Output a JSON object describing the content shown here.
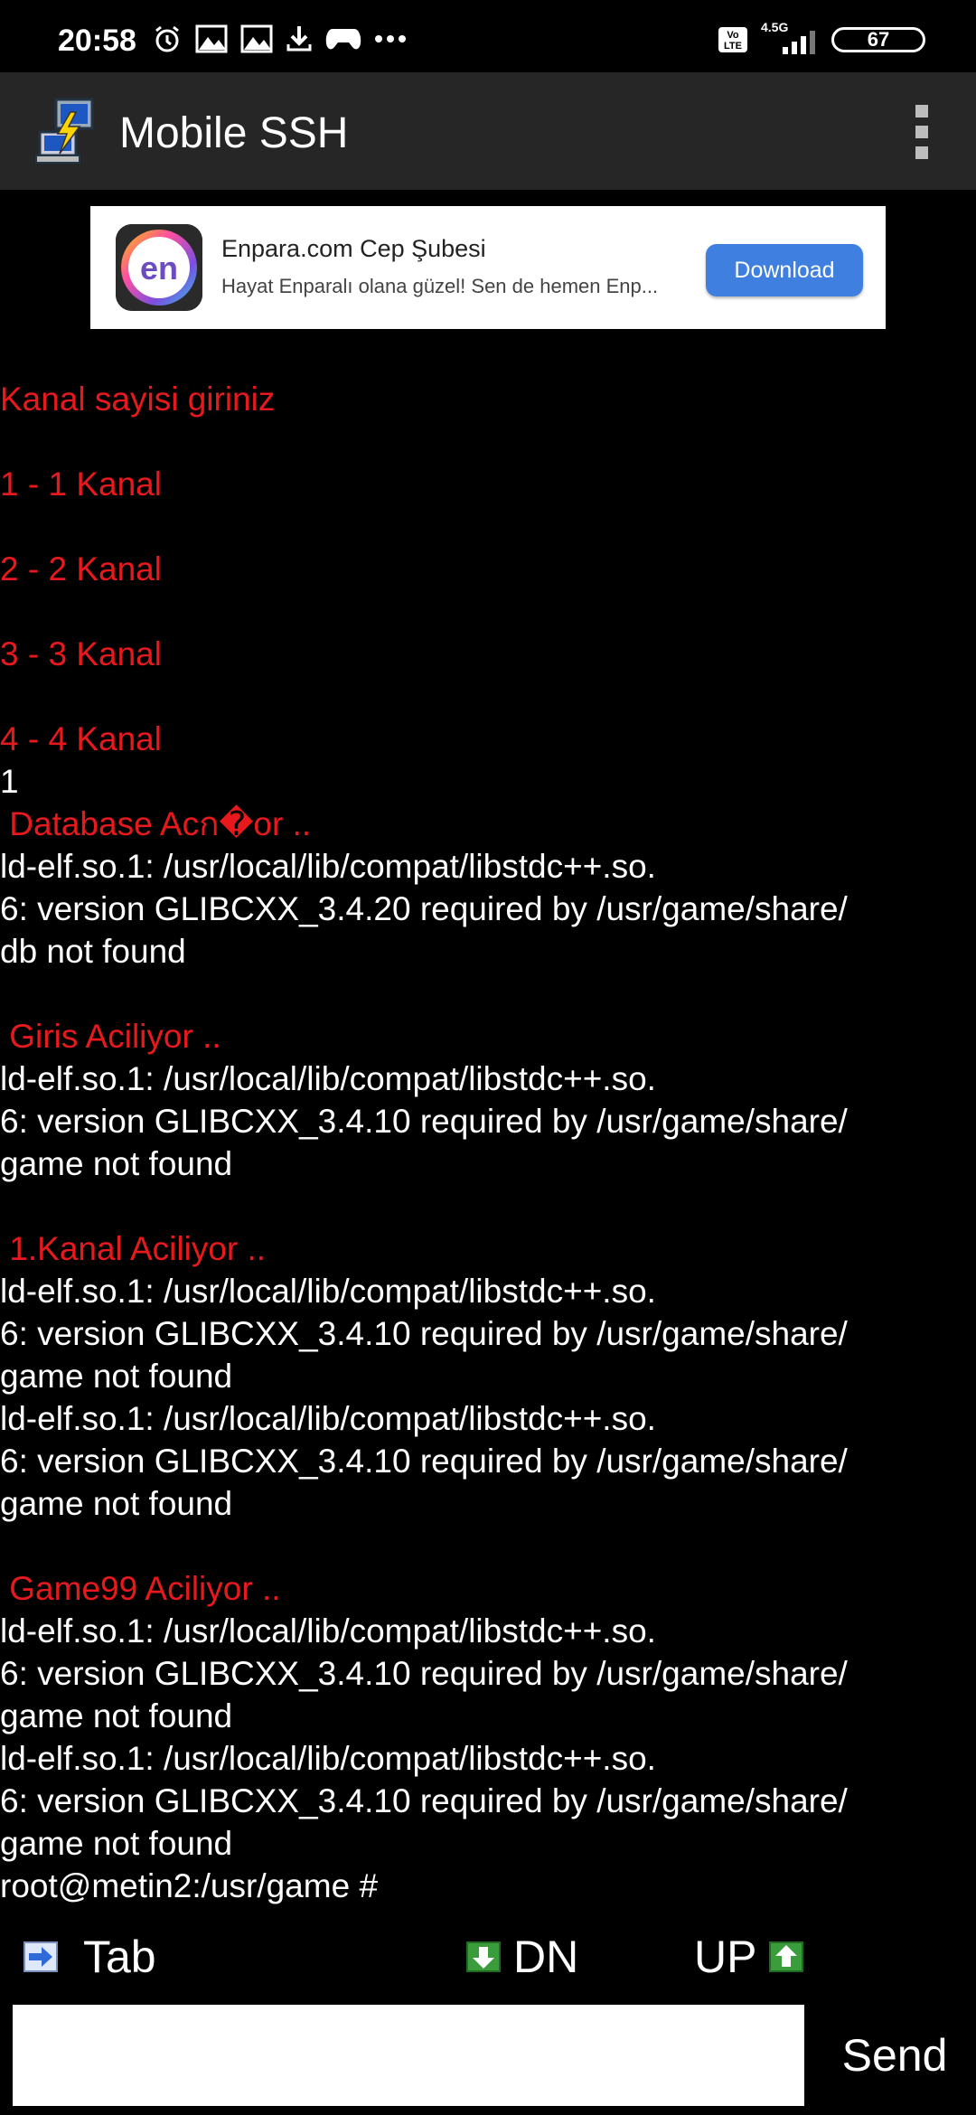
{
  "status_bar": {
    "time": "20:58",
    "network": "4.5G",
    "volte": "Vo LTE",
    "battery": "67",
    "icons": [
      "alarm-icon",
      "gallery-icon",
      "gallery-icon",
      "download-icon",
      "game-controller-icon",
      "more-dots-icon"
    ]
  },
  "app_bar": {
    "title": "Mobile SSH",
    "menu_icon": "overflow-menu-icon"
  },
  "ad": {
    "logo_text": "en",
    "title": "Enpara.com Cep Şubesi",
    "subtitle": "Hayat Enparalı olana güzel! Sen de hemen Enp...",
    "button": "Download"
  },
  "terminal": {
    "lines": [
      {
        "text": "Kanal sayisi giriniz",
        "color": "red"
      },
      {
        "text": "",
        "color": "white"
      },
      {
        "text": "1 - 1 Kanal",
        "color": "red"
      },
      {
        "text": "",
        "color": "white"
      },
      {
        "text": "2 - 2 Kanal",
        "color": "red"
      },
      {
        "text": "",
        "color": "white"
      },
      {
        "text": "3 - 3 Kanal",
        "color": "red"
      },
      {
        "text": "",
        "color": "white"
      },
      {
        "text": "4 - 4 Kanal",
        "color": "red"
      },
      {
        "text": "1",
        "color": "white"
      },
      {
        "text": " Database Acก�or ..",
        "color": "red"
      },
      {
        "text": "ld-elf.so.1: /usr/local/lib/compat/libstdc++.so.",
        "color": "white"
      },
      {
        "text": "6: version GLIBCXX_3.4.20 required by /usr/game/share/",
        "color": "white"
      },
      {
        "text": "db not found",
        "color": "white"
      },
      {
        "text": "",
        "color": "white"
      },
      {
        "text": " Giris Aciliyor ..",
        "color": "red"
      },
      {
        "text": "ld-elf.so.1: /usr/local/lib/compat/libstdc++.so.",
        "color": "white"
      },
      {
        "text": "6: version GLIBCXX_3.4.10 required by /usr/game/share/",
        "color": "white"
      },
      {
        "text": "game not found",
        "color": "white"
      },
      {
        "text": "",
        "color": "white"
      },
      {
        "text": " 1.Kanal Aciliyor ..",
        "color": "red"
      },
      {
        "text": "ld-elf.so.1: /usr/local/lib/compat/libstdc++.so.",
        "color": "white"
      },
      {
        "text": "6: version GLIBCXX_3.4.10 required by /usr/game/share/",
        "color": "white"
      },
      {
        "text": "game not found",
        "color": "white"
      },
      {
        "text": "ld-elf.so.1: /usr/local/lib/compat/libstdc++.so.",
        "color": "white"
      },
      {
        "text": "6: version GLIBCXX_3.4.10 required by /usr/game/share/",
        "color": "white"
      },
      {
        "text": "game not found",
        "color": "white"
      },
      {
        "text": "",
        "color": "white"
      },
      {
        "text": " Game99 Aciliyor ..",
        "color": "red"
      },
      {
        "text": "ld-elf.so.1: /usr/local/lib/compat/libstdc++.so.",
        "color": "white"
      },
      {
        "text": "6: version GLIBCXX_3.4.10 required by /usr/game/share/",
        "color": "white"
      },
      {
        "text": "game not found",
        "color": "white"
      },
      {
        "text": "ld-elf.so.1: /usr/local/lib/compat/libstdc++.so.",
        "color": "white"
      },
      {
        "text": "6: version GLIBCXX_3.4.10 required by /usr/game/share/",
        "color": "white"
      },
      {
        "text": "game not found",
        "color": "white"
      },
      {
        "text": "root@metin2:/usr/game #",
        "color": "white"
      }
    ]
  },
  "keys": {
    "tab": "Tab",
    "dn": "DN",
    "up": "UP"
  },
  "input": {
    "value": "",
    "send": "Send"
  },
  "colors": {
    "terminal_red": "#e8191c",
    "background": "#000000",
    "app_bar": "#262626",
    "ad_button": "#3f7fe0"
  }
}
